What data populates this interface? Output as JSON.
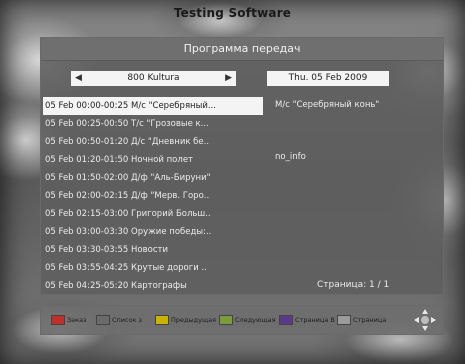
{
  "tv_title": "Testing Software",
  "panel_title": "Программа передач",
  "channel": "800 Kultura",
  "date": "Thu.  05 Feb 2009",
  "events": [
    {
      "label": "05 Feb 00:00-00:25  М/с \"Серебряный..."
    },
    {
      "label": "05 Feb 00:25-00:50  Т/с \"Грозовые к..."
    },
    {
      "label": "05 Feb 00:50-01:20  Д/с \"Дневник бе.."
    },
    {
      "label": "05 Feb 01:20-01:50  Ночной полет"
    },
    {
      "label": "05 Feb 01:50-02:00  Д/ф \"Аль-Бируни\""
    },
    {
      "label": "05 Feb 02:00-02:15  Д/ф \"Мерв. Горо.."
    },
    {
      "label": "05 Feb 02:15-03:00  Григорий Больш.."
    },
    {
      "label": "05 Feb 03:00-03:30  Оружие победы:.."
    },
    {
      "label": "05 Feb 03:30-03:55  Новости"
    },
    {
      "label": "05 Feb 03:55-04:25  Крутые дороги .."
    },
    {
      "label": "05 Feb 04:25-05:20  Картографы"
    }
  ],
  "selected_index": 0,
  "detail": {
    "title": "М/с \"Серебряный конь\"",
    "info": "no_info"
  },
  "page_info": "Страница: 1 / 1",
  "footer": {
    "items": [
      {
        "label": "Заказ",
        "key_color": "#c0302a"
      },
      {
        "label": "Список з",
        "key_color": "#6a6a6a"
      },
      {
        "label": "Предыдущая",
        "key_color": "#c9b400"
      },
      {
        "label": "Следующая",
        "key_color": "#7c9a3a"
      },
      {
        "label": "Страница В",
        "key_color": "#5b3a8a"
      },
      {
        "label": "Страница",
        "key_color": "#999999"
      }
    ]
  },
  "colors": {
    "panel_bg": "#5f5f5f",
    "selected_row_bg": "#f4f4f4"
  }
}
